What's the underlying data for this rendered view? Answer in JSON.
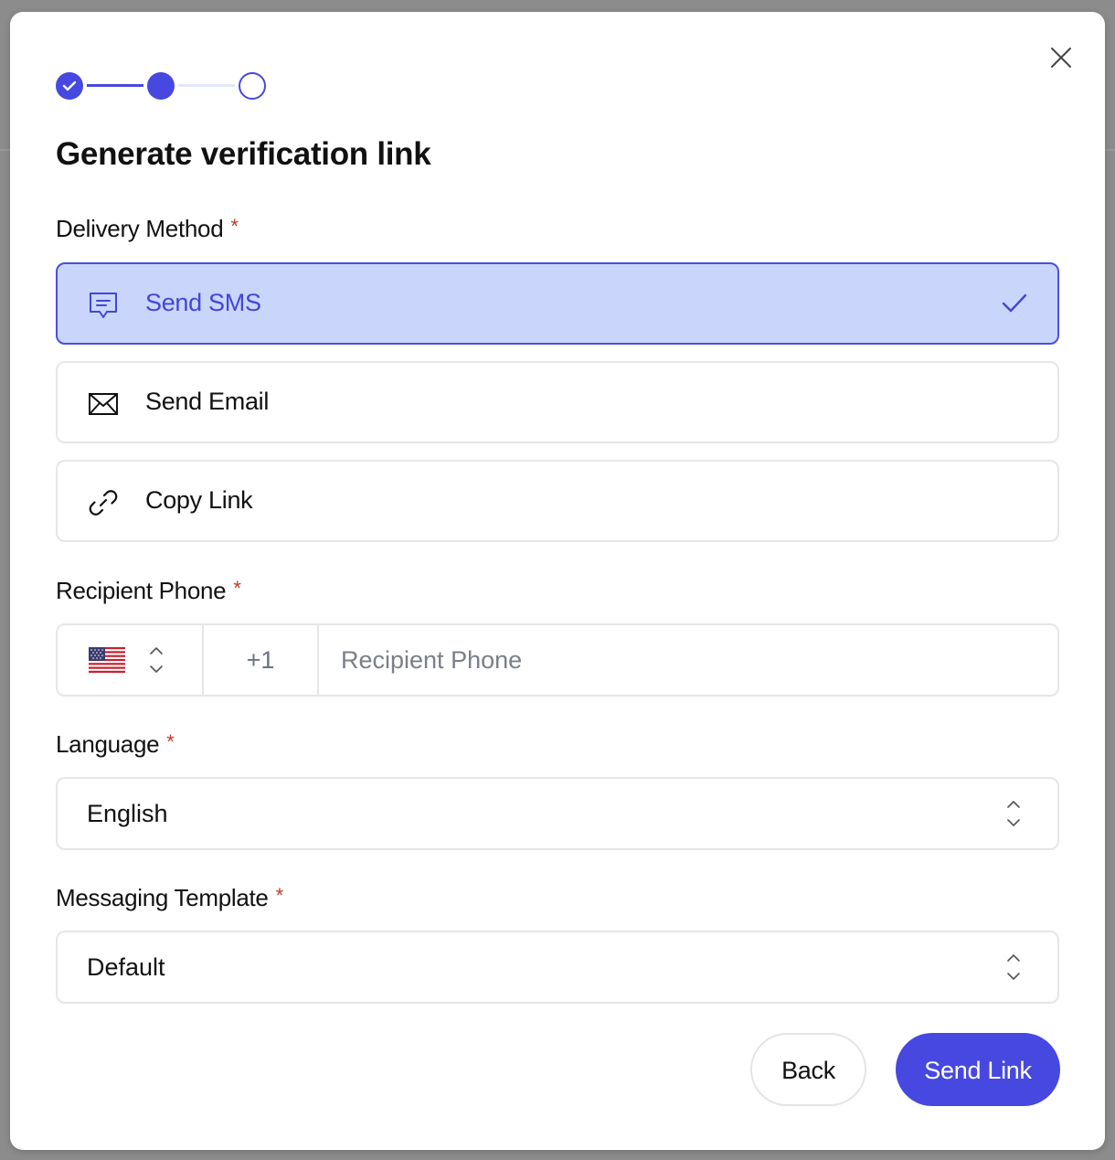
{
  "modal": {
    "title": "Generate verification link",
    "close_icon": "close-icon"
  },
  "stepper": {
    "steps": [
      {
        "state": "complete",
        "icon": "check-icon"
      },
      {
        "state": "current"
      },
      {
        "state": "upcoming"
      }
    ]
  },
  "delivery": {
    "label": "Delivery Method",
    "required_mark": "*",
    "options": [
      {
        "label": "Send SMS",
        "icon": "message-icon",
        "selected": true
      },
      {
        "label": "Send Email",
        "icon": "envelope-icon",
        "selected": false
      },
      {
        "label": "Copy Link",
        "icon": "link-icon",
        "selected": false
      }
    ]
  },
  "phone": {
    "label": "Recipient Phone",
    "required_mark": "*",
    "country_flag": "us-flag-icon",
    "dial_code": "+1",
    "value": "",
    "placeholder": "Recipient Phone"
  },
  "language": {
    "label": "Language",
    "required_mark": "*",
    "value": "English"
  },
  "template": {
    "label": "Messaging Template",
    "required_mark": "*",
    "value": "Default"
  },
  "actions": {
    "back_label": "Back",
    "send_label": "Send Link"
  },
  "colors": {
    "accent": "#4648e0",
    "selected_bg": "#c9d5fb",
    "required": "#c0392b"
  }
}
